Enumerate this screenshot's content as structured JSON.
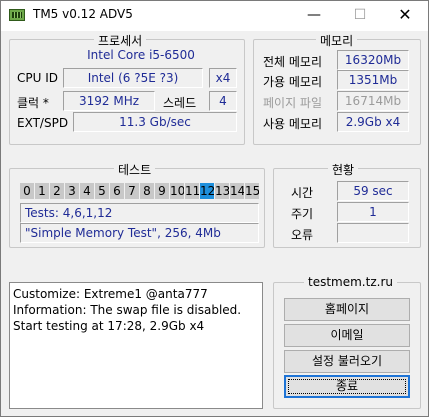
{
  "window": {
    "title": "TM5 v0.12 ADV5",
    "min": "—",
    "max": "☐",
    "close": "✕"
  },
  "processor": {
    "group_title": "프로세서",
    "cpu_name": "Intel Core i5-6500",
    "cpu_id_label": "CPU ID",
    "cpu_id_value": "Intel  (6 ?5E ?3)",
    "cores_value": "x4",
    "clock_label": "클럭 *",
    "clock_value": "3192 MHz",
    "threads_label": "스레드",
    "threads_value": "4",
    "ext_label": "EXT/SPD",
    "ext_value": "11.3 Gb/sec"
  },
  "memory": {
    "group_title": "메모리",
    "total_label": "전체 메모리",
    "total_value": "16320Mb",
    "available_label": "가용 메모리",
    "available_value": "1351Mb",
    "pagefile_label": "페이지 파일",
    "pagefile_value": "16714Mb",
    "used_label": "사용 메모리",
    "used_value": "2.9Gb x4"
  },
  "test": {
    "group_title": "테스트",
    "cells": [
      "0",
      "1",
      "2",
      "3",
      "4",
      "5",
      "6",
      "7",
      "8",
      "9",
      "10",
      "11",
      "12",
      "13",
      "14",
      "15"
    ],
    "active_index": 12,
    "tests_line": "Tests: 4,6,1,12",
    "config_line": "\"Simple Memory Test\", 256, 4Mb"
  },
  "status": {
    "group_title": "현황",
    "time_label": "시간",
    "time_value": "59 sec",
    "cycle_label": "주기",
    "cycle_value": "1",
    "error_label": "오류",
    "error_value": ""
  },
  "log": {
    "lines": [
      "Customize: Extreme1 @anta777",
      "Information: The swap file is disabled.",
      "Start testing at 17:28, 2.9Gb x4"
    ]
  },
  "actions": {
    "site": "testmem.tz.ru",
    "homepage": "홈페이지",
    "email": "이메일",
    "load_settings": "설정 불러오기",
    "exit": "종료"
  },
  "colors": {
    "value_text": "#1f2b96",
    "active_test": "#1e8fdc",
    "default_button_border": "#1e74d6"
  }
}
